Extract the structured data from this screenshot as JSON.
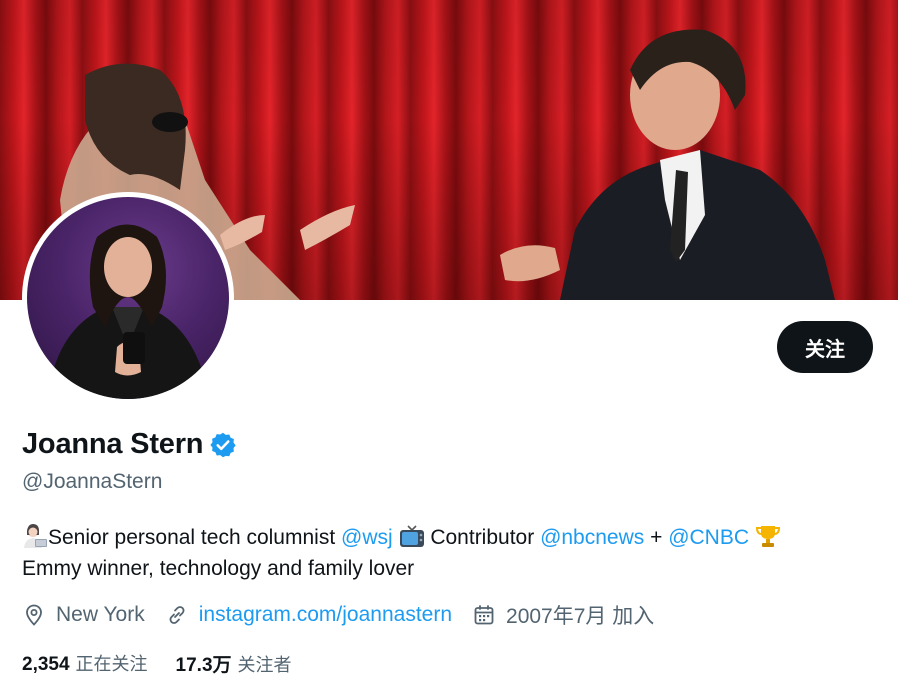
{
  "profile": {
    "display_name": "Joanna Stern",
    "handle": "@JoannaStern",
    "follow_label": "关注",
    "verified": true
  },
  "bio": {
    "part1": "Senior personal tech columnist ",
    "mention_wsj": "@wsj",
    "part2": " Contributor ",
    "mention_nbc": "@nbcnews",
    "plus": " + ",
    "mention_cnbc": "@CNBC",
    "line2": "Emmy winner, technology and family lover"
  },
  "meta": {
    "location": "New York",
    "website": "instagram.com/joannastern",
    "joined": "2007年7月 加入"
  },
  "stats": {
    "following_count": "2,354",
    "following_label": "正在关注",
    "followers_count": "17.3万",
    "followers_label": "关注者"
  },
  "icons": {
    "verified": "verified-badge-icon",
    "location": "location-pin-icon",
    "link": "link-icon",
    "calendar": "calendar-icon"
  },
  "colors": {
    "accent": "#1d9bf0",
    "text": "#0f1419",
    "muted": "#536471",
    "button_bg": "#0f1419"
  }
}
